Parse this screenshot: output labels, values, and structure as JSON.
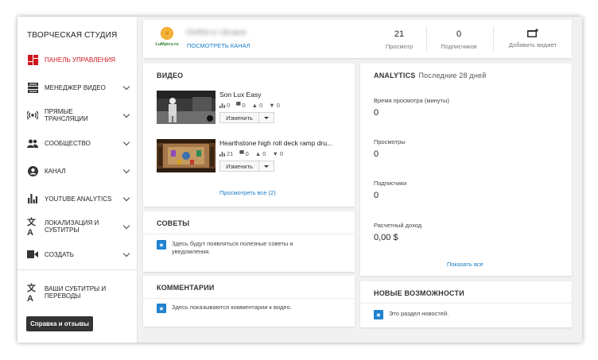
{
  "sidebar": {
    "title": "ТВОРЧЕСКАЯ СТУДИЯ",
    "items": [
      {
        "label": "ПАНЕЛЬ УПРАВЛЕНИЯ",
        "icon": "dashboard-icon",
        "active": true
      },
      {
        "label": "МЕНЕДЖЕР ВИДЕО",
        "icon": "video-manager-icon"
      },
      {
        "label": "ПРЯМЫЕ ТРАНСЛЯЦИИ",
        "icon": "live-stream-icon"
      },
      {
        "label": "СООБЩЕСТВО",
        "icon": "community-icon"
      },
      {
        "label": "КАНАЛ",
        "icon": "channel-icon"
      },
      {
        "label": "YOUTUBE ANALYTICS",
        "icon": "analytics-icon"
      },
      {
        "label": "ЛОКАЛИЗАЦИЯ И СУБТИТРЫ",
        "icon": "translate-icon"
      },
      {
        "label": "СОЗДАТЬ",
        "icon": "create-icon"
      }
    ],
    "subtitles_label": "ВАШИ СУБТИТРЫ И ПЕРЕВОДЫ",
    "help_button": "Справка и отзывы"
  },
  "header": {
    "channel_name": "OHRA in Ukraine",
    "view_channel": "ПОСМОТРЕТЬ КАНАЛ",
    "views_count": "21",
    "views_label": "Просмотр",
    "subscribers_count": "0",
    "subscribers_label": "Подписчиков",
    "add_widget_label": "Добавить виджет",
    "logo_text": "LuMpics.ru"
  },
  "video": {
    "title": "ВИДЕО",
    "items": [
      {
        "title": "Son Lux Easy",
        "views": "0",
        "comments": "0",
        "likes": "0",
        "dislikes": "0",
        "edit": "Изменить"
      },
      {
        "title": "Hearthstone high roll deck ramp dru...",
        "views": "21",
        "comments": "0",
        "likes": "0",
        "dislikes": "0",
        "edit": "Изменить"
      }
    ],
    "view_all": "Просмотреть все (2)"
  },
  "tips": {
    "title": "СОВЕТЫ",
    "text": "Здесь будут появляться полезные советы и уведомления."
  },
  "comments": {
    "title": "КОММЕНТАРИИ",
    "text": "Здесь показываются комментарии к видео."
  },
  "analytics": {
    "title": "ANALYTICS",
    "period": "Последние 28 дней",
    "metrics": [
      {
        "label": "Время просмотра (минуты)",
        "value": "0"
      },
      {
        "label": "Просмотры",
        "value": "0"
      },
      {
        "label": "Подписчики",
        "value": "0"
      },
      {
        "label": "Расчетный доход",
        "value": "0,00 $"
      }
    ],
    "show_all": "Показать все"
  },
  "news": {
    "title": "НОВЫЕ ВОЗМОЖНОСТИ",
    "text": "Это раздел новостей."
  },
  "colors": {
    "accent_red": "#cc181e",
    "link_blue": "#167ac6",
    "info_blue": "#1f82d1"
  }
}
